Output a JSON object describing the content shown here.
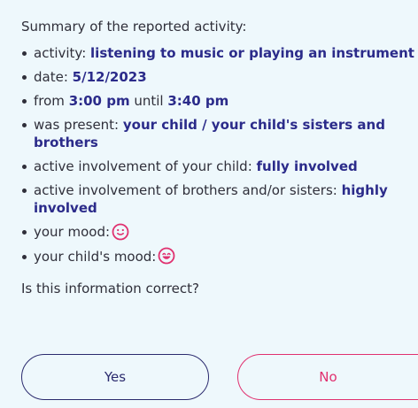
{
  "summary": {
    "title": "Summary of the reported activity:",
    "activity_label": "activity: ",
    "activity_value": "listening to music or playing an instrument",
    "date_label": "date: ",
    "date_value": "5/12/2023",
    "from_label": "from ",
    "from_value": "3:00 pm",
    "until_label": " until ",
    "until_value": "3:40 pm",
    "present_label": "was present: ",
    "present_value": "your child / your child's sisters and brothers",
    "child_involvement_label": "active involvement of your child: ",
    "child_involvement_value": "fully involved",
    "siblings_involvement_label": "active involvement of brothers and/or sisters: ",
    "siblings_involvement_value": "highly involved",
    "your_mood_label": "your mood:",
    "your_mood_icon": "slightly-smiling-face-icon",
    "child_mood_label": "your child's mood:",
    "child_mood_icon": "happy-face-icon"
  },
  "question": "Is this information correct?",
  "buttons": {
    "yes": "Yes",
    "no": "No"
  },
  "colors": {
    "background": "#eef8fc",
    "value_text": "#2b2b8a",
    "yes_border": "#2b2b6e",
    "no_border": "#e0306f",
    "mood_icon": "#e0306f"
  }
}
